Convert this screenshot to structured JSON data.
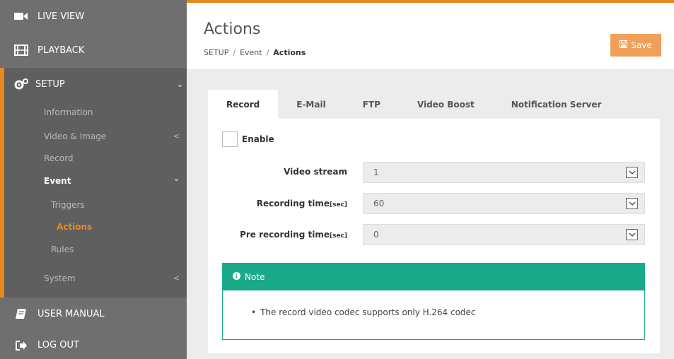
{
  "sidebar": {
    "live_view": "LIVE VIEW",
    "playback": "PLAYBACK",
    "setup": "SETUP",
    "items": {
      "information": "Information",
      "video_image": "Video & Image",
      "record": "Record",
      "event": "Event",
      "triggers": "Triggers",
      "actions": "Actions",
      "rules": "Rules",
      "system": "System"
    },
    "user_manual": "USER MANUAL",
    "log_out": "LOG OUT"
  },
  "header": {
    "title": "Actions",
    "breadcrumb": [
      "SETUP",
      "Event",
      "Actions"
    ],
    "save_label": "Save"
  },
  "tabs": [
    "Record",
    "E-Mail",
    "FTP",
    "Video Boost",
    "Notification Server"
  ],
  "form": {
    "enable_label": "Enable",
    "video_stream": {
      "label": "Video stream",
      "value": "1"
    },
    "recording_time": {
      "label": "Recording time",
      "unit": "[sec]",
      "value": "60"
    },
    "pre_recording_time": {
      "label": "Pre recording time",
      "unit": "[sec]",
      "value": "0"
    }
  },
  "note": {
    "title": "Note",
    "text": "The record video codec supports only H.264 codec"
  },
  "colors": {
    "accent": "#e8891e",
    "note": "#1aaa8a",
    "sidebar": "#6f6f6f"
  }
}
